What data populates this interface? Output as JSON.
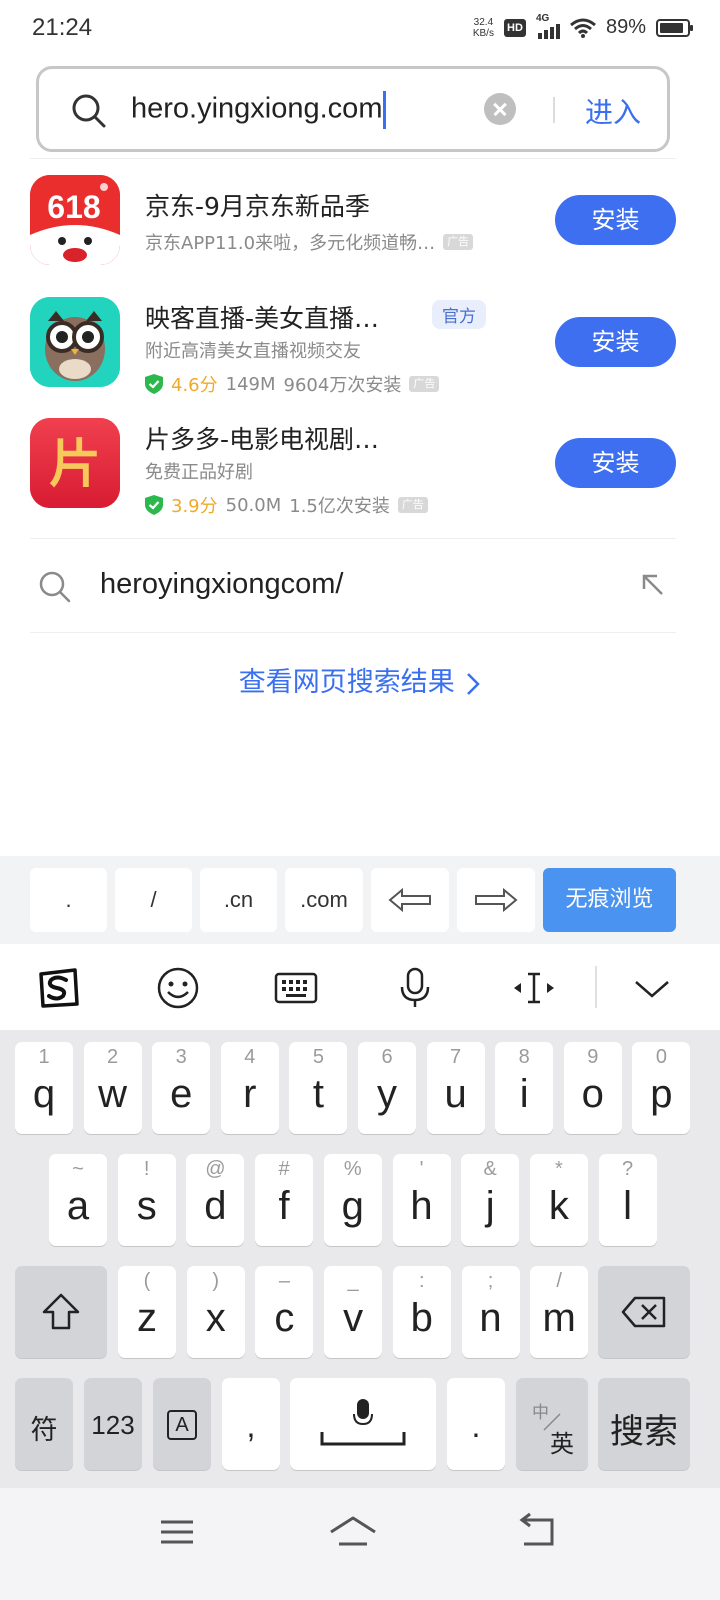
{
  "status_bar": {
    "time": "21:24",
    "net_speed_value": "32.4",
    "net_speed_unit": "KB/s",
    "hd_label": "HD",
    "network": "4G",
    "battery_percent": "89%",
    "battery_level": 0.89
  },
  "search": {
    "query": "hero.yingxiong.com",
    "enter_label": "进入"
  },
  "apps": [
    {
      "name": "京东-9月京东新品季",
      "desc": "京东APP11.0来啦，多元化频道畅…",
      "ad_label": "广告",
      "install_label": "安装",
      "icon": "jd-618-icon",
      "icon_text": "618"
    },
    {
      "name": "映客直播-美女直播…",
      "official_label": "官方",
      "desc": "附近高清美女直播视频交友",
      "rating": "4.6分",
      "size": "149M",
      "installs": "9604万次安装",
      "ad_label": "广告",
      "install_label": "安装",
      "icon": "owl-icon"
    },
    {
      "name": "片多多-电影电视剧…",
      "desc": "免费正品好剧",
      "rating": "3.9分",
      "size": "50.0M",
      "installs": "1.5亿次安装",
      "ad_label": "广告",
      "install_label": "安装",
      "icon": "pian-icon",
      "icon_text": "片"
    }
  ],
  "suggestion": {
    "text": "heroyingxiongcom/"
  },
  "web_results_label": "查看网页搜索结果",
  "keyboard": {
    "shortcuts": [
      ".",
      "/",
      ".cn",
      ".com"
    ],
    "incognito_label": "无痕浏览",
    "row1": [
      {
        "num": "1",
        "ch": "q"
      },
      {
        "num": "2",
        "ch": "w"
      },
      {
        "num": "3",
        "ch": "e"
      },
      {
        "num": "4",
        "ch": "r"
      },
      {
        "num": "5",
        "ch": "t"
      },
      {
        "num": "6",
        "ch": "y"
      },
      {
        "num": "7",
        "ch": "u"
      },
      {
        "num": "8",
        "ch": "i"
      },
      {
        "num": "9",
        "ch": "o"
      },
      {
        "num": "0",
        "ch": "p"
      }
    ],
    "row2": [
      {
        "num": "~",
        "ch": "a"
      },
      {
        "num": "!",
        "ch": "s"
      },
      {
        "num": "@",
        "ch": "d"
      },
      {
        "num": "#",
        "ch": "f"
      },
      {
        "num": "%",
        "ch": "g"
      },
      {
        "num": "'",
        "ch": "h"
      },
      {
        "num": "&",
        "ch": "j"
      },
      {
        "num": "*",
        "ch": "k"
      },
      {
        "num": "?",
        "ch": "l"
      }
    ],
    "row3": [
      {
        "num": "(",
        "ch": "z"
      },
      {
        "num": ")",
        "ch": "x"
      },
      {
        "num": "–",
        "ch": "c"
      },
      {
        "num": "_",
        "ch": "v"
      },
      {
        "num": ":",
        "ch": "b"
      },
      {
        "num": ";",
        "ch": "n"
      },
      {
        "num": "/",
        "ch": "m"
      }
    ],
    "symbols_label": "符",
    "numbers_label": "123",
    "caps_label": "A",
    "comma_label": ",",
    "period_label": ".",
    "lang_top": "中",
    "lang_bottom": "英",
    "search_label": "搜索"
  },
  "colors": {
    "accent": "#3e6ff0",
    "rating": "#f0a92a",
    "verified": "#2db84d",
    "incognito": "#4b93f0"
  }
}
